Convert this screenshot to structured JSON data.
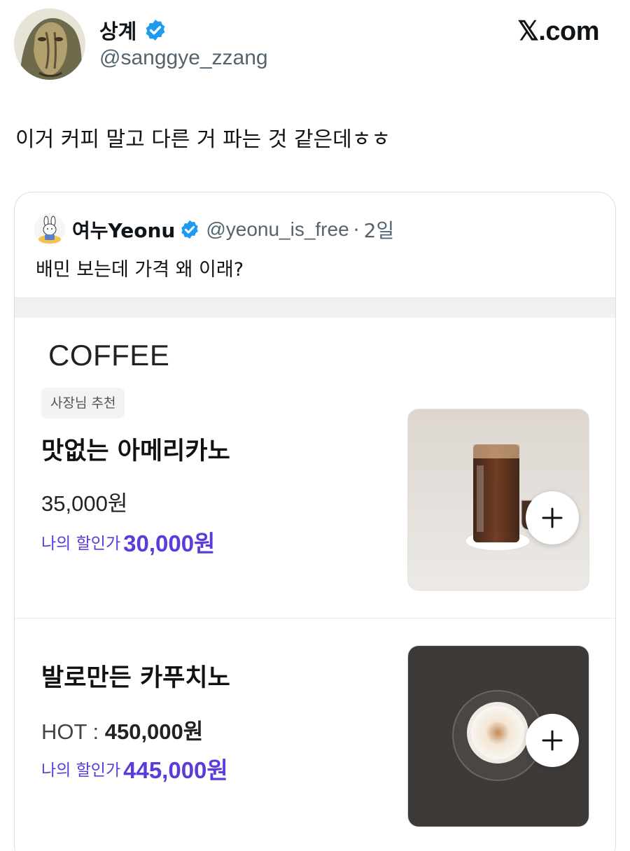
{
  "post": {
    "author": {
      "name": "상계",
      "handle": "@sanggye_zzang",
      "verified_color": "#1d9bf0"
    },
    "brand": "𝕏.com",
    "text": "이거 커피 말고 다른 거 파는 것 같은데ㅎㅎ"
  },
  "quote": {
    "author": {
      "name": "여누Yeonu",
      "handle": "@yeonu_is_free",
      "separator": "·",
      "time": "2일"
    },
    "text": "배민 보는데 가격 왜 이래?",
    "menu": {
      "category": "COFFEE",
      "accent_color": "#5b3bd9",
      "items": [
        {
          "badge": "사장님 추천",
          "name": "맛없는 아메리카노",
          "price_label": "",
          "price": "35,000원",
          "discount_label": "나의 할인가",
          "discount_price": "30,000원",
          "image": "iced-americano"
        },
        {
          "badge": "",
          "name": "발로만든 카푸치노",
          "price_label": "HOT : ",
          "price": "450,000원",
          "discount_label": "나의 할인가",
          "discount_price": "445,000원",
          "image": "cappuccino"
        }
      ]
    }
  }
}
